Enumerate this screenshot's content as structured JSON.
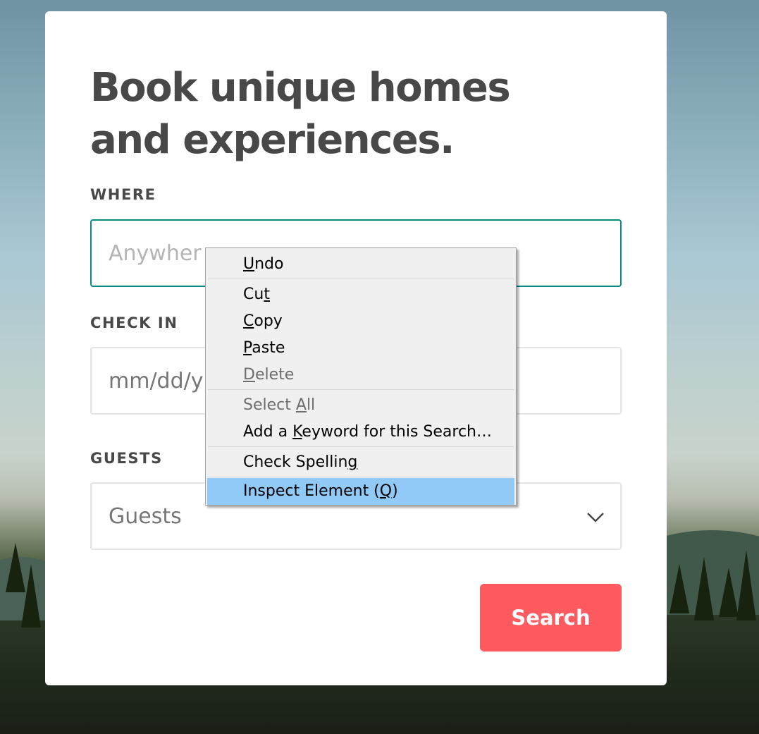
{
  "colors": {
    "accent_teal": "#0a8a85",
    "search_button": "#ff5a5f",
    "heading_text": "#484848",
    "menu_highlight": "#91c9f7"
  },
  "booking": {
    "title": "Book unique homes and experiences.",
    "where": {
      "label": "WHERE",
      "placeholder": "Anywhere",
      "visible_text": "Anywher"
    },
    "check_in": {
      "label": "CHECK IN",
      "placeholder": "mm/dd/yyyy",
      "visible_text": "mm/dd/y"
    },
    "guests": {
      "label": "GUESTS",
      "selected": "Guests",
      "icon": "chevron-down-icon"
    },
    "search_button": "Search"
  },
  "context_menu": {
    "items": [
      {
        "pre": "",
        "key": "U",
        "post": "ndo",
        "enabled": true
      },
      {
        "pre": "Cu",
        "key": "t",
        "post": "",
        "enabled": true
      },
      {
        "pre": "",
        "key": "C",
        "post": "opy",
        "enabled": true
      },
      {
        "pre": "",
        "key": "P",
        "post": "aste",
        "enabled": true
      },
      {
        "pre": "",
        "key": "D",
        "post": "elete",
        "enabled": false
      },
      {
        "pre": "Select ",
        "key": "A",
        "post": "ll",
        "enabled": false
      },
      {
        "pre": "Add a ",
        "key": "K",
        "post": "eyword for this Search…",
        "enabled": true
      },
      {
        "pre": "Check Spellin",
        "key": "g",
        "post": "",
        "enabled": true
      },
      {
        "pre": "Inspect Element (",
        "key": "Q",
        "post": ")",
        "enabled": true,
        "highlighted": true
      }
    ]
  }
}
